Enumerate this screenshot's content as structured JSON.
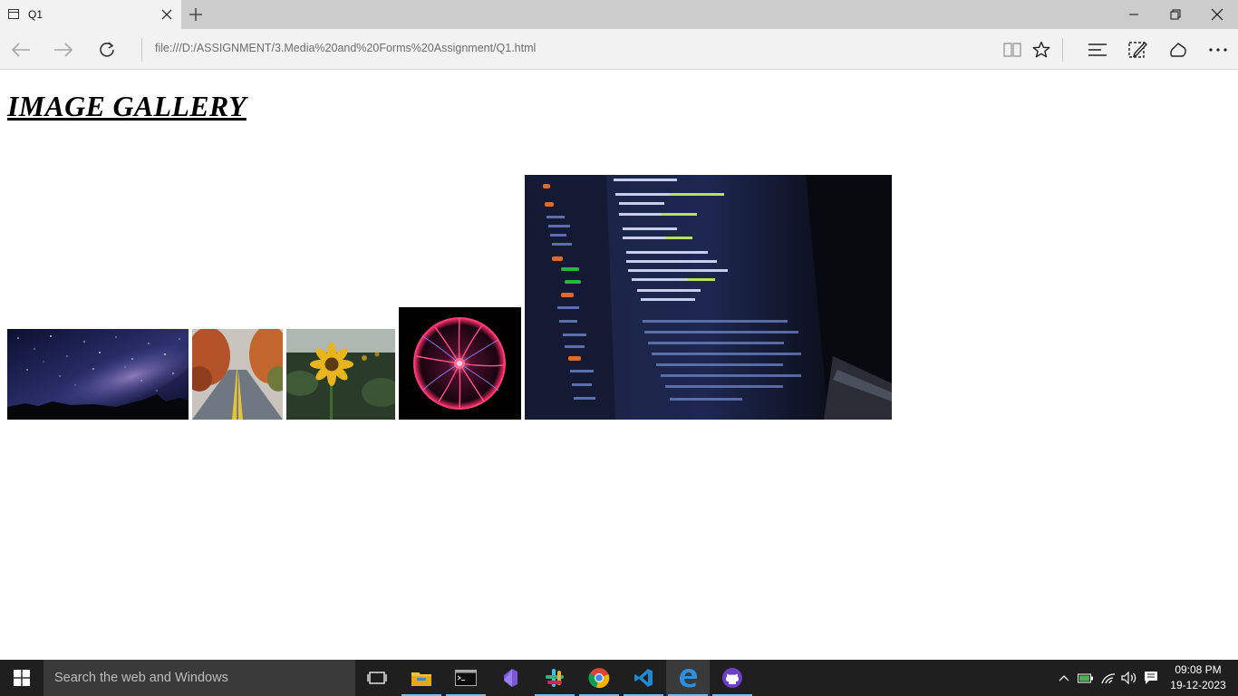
{
  "browser": {
    "tab_title": "Q1",
    "address": "file:///D:/ASSIGNMENT/3.Media%20and%20Forms%20Assignment/Q1.html"
  },
  "page": {
    "heading": "IMAGE GALLERY",
    "images": [
      {
        "subject": "starry-night-sky",
        "colors": [
          "#0a0d24",
          "#3b3f8a",
          "#8a7fb8"
        ]
      },
      {
        "subject": "autumn-road",
        "colors": [
          "#b4532a",
          "#7b8591",
          "#3a3f46"
        ]
      },
      {
        "subject": "sunflower",
        "colors": [
          "#e3b21a",
          "#2f4a2a",
          "#a9b3a6"
        ]
      },
      {
        "subject": "plasma-ball",
        "colors": [
          "#000000",
          "#ff2f6b",
          "#7a6cff"
        ]
      },
      {
        "subject": "code-laptop",
        "colors": [
          "#0a0c14",
          "#24305a",
          "#4a78c8"
        ]
      }
    ]
  },
  "taskbar": {
    "search_placeholder": "Search the web and Windows",
    "apps": [
      "task-view",
      "file-explorer",
      "command-prompt",
      "visual-studio",
      "slack",
      "chrome",
      "vscode",
      "edge",
      "github-desktop"
    ],
    "active_app": "edge",
    "clock_time": "09:08 PM",
    "clock_date": "19-12-2023"
  },
  "colors": {
    "tabbar_bg": "#cccccc",
    "toolbar_bg": "#f2f2f2",
    "taskbar_bg": "#1f1f1f",
    "search_bg": "#3a3a3a",
    "accent": "#76b9ed"
  }
}
